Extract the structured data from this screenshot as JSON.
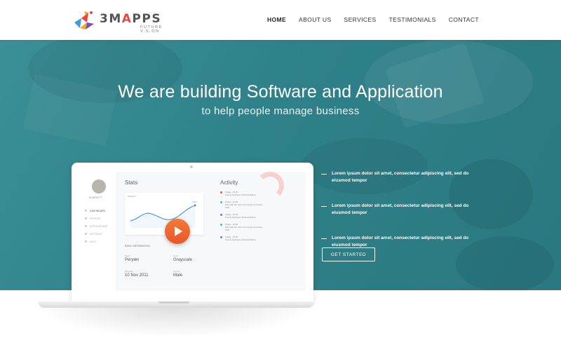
{
  "brand": {
    "name_prefix": "3M",
    "name_accent": "A",
    "name_suffix": "PPS",
    "tagline": "FUTURE V.S.ON",
    "logo_colors": [
      "#e8473c",
      "#f5a623",
      "#3a9fd6",
      "#7b4fb3"
    ]
  },
  "nav": {
    "items": [
      {
        "label": "HOME",
        "active": true
      },
      {
        "label": "ABOUT US",
        "active": false
      },
      {
        "label": "SERVICES",
        "active": false
      },
      {
        "label": "TESTIMONIALS",
        "active": false
      },
      {
        "label": "CONTACT",
        "active": false
      }
    ]
  },
  "hero": {
    "title": "We are building Software and Application",
    "subtitle": "to help people manage business",
    "features": [
      "Lorem ipsum dolor sit amet, consectetur adipiscing elit, sed do eiusmod tempor",
      "Lorem ipsum dolor sit amet, consectetur adipiscing elit, sed do eiusmod tempor",
      "Lorem ipsum dolor sit amet, consectetur adipiscing elit, sed do eiusmod tempor"
    ],
    "cta_label": "GET STARTED",
    "accent_color": "#2f8189"
  },
  "mockup": {
    "user_name": "SCARLETT",
    "menu": [
      "DASHBOARD",
      "PROFILE",
      "APPLICATIONS",
      "SETTINGS",
      "HELP"
    ],
    "stats_title": "Stats",
    "chart_label": "WEIGHT",
    "chart_peak_label": "8.0M",
    "basic_info_label": "BASIC INFORMATION",
    "fields": [
      {
        "label": "Brand",
        "value": "Peryien"
      },
      {
        "label": "Color",
        "value": "Grayscale"
      },
      {
        "label": "Birthdate",
        "value": "10 Nov 2011"
      },
      {
        "label": "Gender",
        "value": "Male"
      }
    ],
    "activity_title": "Activity",
    "activity": [
      {
        "time": "Today - 12:30",
        "text": "Post to Sydnheo (Outlook Births)",
        "color": "#e85a5a"
      },
      {
        "time": "Today - 12:30",
        "text": "Play with the user community at Central Park",
        "color": "#3fc6a8"
      },
      {
        "time": "Today - 12:30",
        "text": "Post to Sydnheo (Outlook Births)",
        "color": "#7a7ad6"
      },
      {
        "time": "Today - 12:30",
        "text": "Play with the user community at Central Park",
        "color": "#3fc6a8"
      },
      {
        "time": "Today - 12:30",
        "text": "Post to Sydnheo (Outlook Births)",
        "color": "#7a7ad6"
      }
    ],
    "play_button_color": "#ef6a30"
  }
}
